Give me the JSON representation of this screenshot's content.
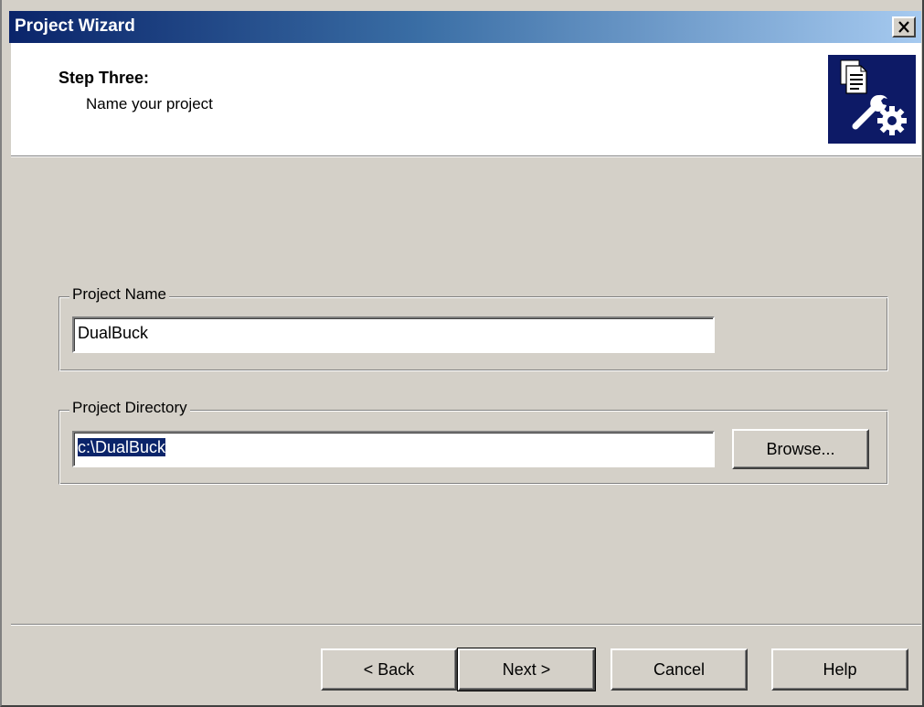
{
  "window": {
    "title": "Project Wizard"
  },
  "header": {
    "step_title": "Step Three:",
    "step_subtitle": "Name your project",
    "icon": "wizard-document-wrench-gear-icon"
  },
  "project_name": {
    "label": "Project Name",
    "value": "DualBuck"
  },
  "project_directory": {
    "label": "Project Directory",
    "value": "c:\\DualBuck",
    "browse_label": "Browse..."
  },
  "footer": {
    "back_label": "< Back",
    "next_label": "Next >",
    "cancel_label": "Cancel",
    "help_label": "Help"
  },
  "colors": {
    "title_bar": "#0a246a",
    "face": "#d4d0c8",
    "selection": "#0a246a",
    "icon_bg": "#0d1a66"
  }
}
